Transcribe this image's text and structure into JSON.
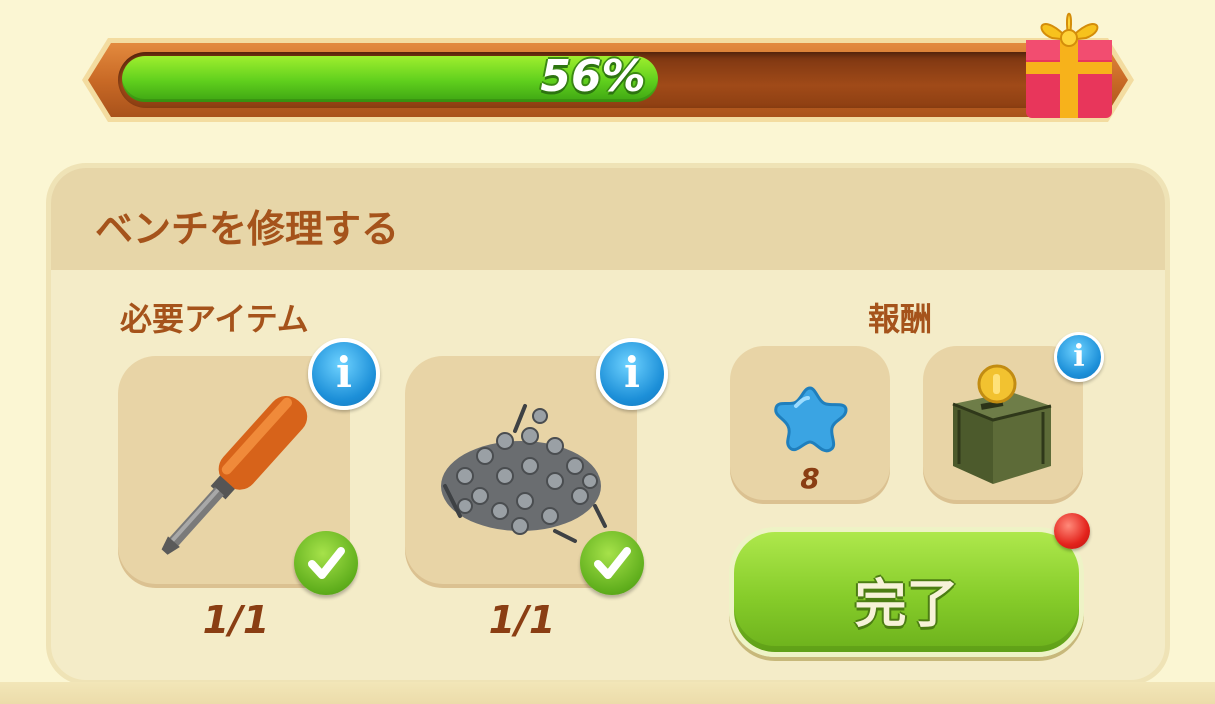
{
  "progress": {
    "percent": 56,
    "label": "56%"
  },
  "quest": {
    "title": "ベンチを修理する",
    "required_label": "必要アイテム",
    "reward_label": "報酬",
    "required_items": [
      {
        "icon": "screwdriver-icon",
        "count": "1/1",
        "completed": true
      },
      {
        "icon": "screws-icon",
        "count": "1/1",
        "completed": true
      }
    ],
    "rewards": [
      {
        "icon": "blue-star-icon",
        "amount": "8"
      },
      {
        "icon": "coin-box-icon"
      }
    ],
    "complete_button": "完了"
  },
  "colors": {
    "background": "#fbf6d3",
    "title_text": "#a5531b",
    "progress_fill": "#5fcf1d",
    "button_green": "#86cc2a",
    "info_blue": "#1c8fd8"
  }
}
